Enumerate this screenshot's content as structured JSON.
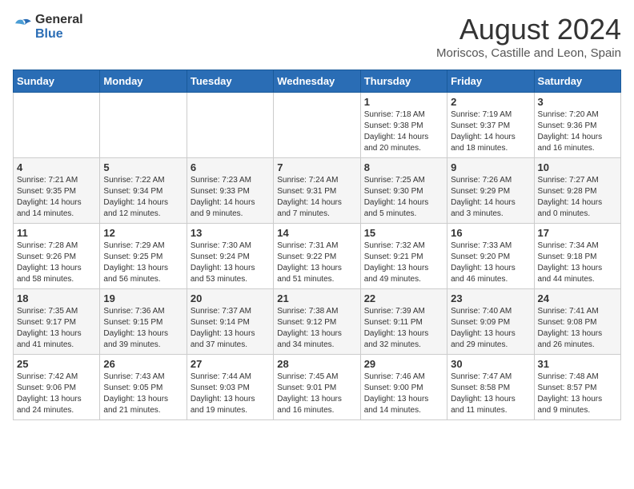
{
  "header": {
    "logo_general": "General",
    "logo_blue": "Blue",
    "month_year": "August 2024",
    "location": "Moriscos, Castille and Leon, Spain"
  },
  "weekdays": [
    "Sunday",
    "Monday",
    "Tuesday",
    "Wednesday",
    "Thursday",
    "Friday",
    "Saturday"
  ],
  "weeks": [
    [
      {
        "day": "",
        "info": ""
      },
      {
        "day": "",
        "info": ""
      },
      {
        "day": "",
        "info": ""
      },
      {
        "day": "",
        "info": ""
      },
      {
        "day": "1",
        "info": "Sunrise: 7:18 AM\nSunset: 9:38 PM\nDaylight: 14 hours and 20 minutes."
      },
      {
        "day": "2",
        "info": "Sunrise: 7:19 AM\nSunset: 9:37 PM\nDaylight: 14 hours and 18 minutes."
      },
      {
        "day": "3",
        "info": "Sunrise: 7:20 AM\nSunset: 9:36 PM\nDaylight: 14 hours and 16 minutes."
      }
    ],
    [
      {
        "day": "4",
        "info": "Sunrise: 7:21 AM\nSunset: 9:35 PM\nDaylight: 14 hours and 14 minutes."
      },
      {
        "day": "5",
        "info": "Sunrise: 7:22 AM\nSunset: 9:34 PM\nDaylight: 14 hours and 12 minutes."
      },
      {
        "day": "6",
        "info": "Sunrise: 7:23 AM\nSunset: 9:33 PM\nDaylight: 14 hours and 9 minutes."
      },
      {
        "day": "7",
        "info": "Sunrise: 7:24 AM\nSunset: 9:31 PM\nDaylight: 14 hours and 7 minutes."
      },
      {
        "day": "8",
        "info": "Sunrise: 7:25 AM\nSunset: 9:30 PM\nDaylight: 14 hours and 5 minutes."
      },
      {
        "day": "9",
        "info": "Sunrise: 7:26 AM\nSunset: 9:29 PM\nDaylight: 14 hours and 3 minutes."
      },
      {
        "day": "10",
        "info": "Sunrise: 7:27 AM\nSunset: 9:28 PM\nDaylight: 14 hours and 0 minutes."
      }
    ],
    [
      {
        "day": "11",
        "info": "Sunrise: 7:28 AM\nSunset: 9:26 PM\nDaylight: 13 hours and 58 minutes."
      },
      {
        "day": "12",
        "info": "Sunrise: 7:29 AM\nSunset: 9:25 PM\nDaylight: 13 hours and 56 minutes."
      },
      {
        "day": "13",
        "info": "Sunrise: 7:30 AM\nSunset: 9:24 PM\nDaylight: 13 hours and 53 minutes."
      },
      {
        "day": "14",
        "info": "Sunrise: 7:31 AM\nSunset: 9:22 PM\nDaylight: 13 hours and 51 minutes."
      },
      {
        "day": "15",
        "info": "Sunrise: 7:32 AM\nSunset: 9:21 PM\nDaylight: 13 hours and 49 minutes."
      },
      {
        "day": "16",
        "info": "Sunrise: 7:33 AM\nSunset: 9:20 PM\nDaylight: 13 hours and 46 minutes."
      },
      {
        "day": "17",
        "info": "Sunrise: 7:34 AM\nSunset: 9:18 PM\nDaylight: 13 hours and 44 minutes."
      }
    ],
    [
      {
        "day": "18",
        "info": "Sunrise: 7:35 AM\nSunset: 9:17 PM\nDaylight: 13 hours and 41 minutes."
      },
      {
        "day": "19",
        "info": "Sunrise: 7:36 AM\nSunset: 9:15 PM\nDaylight: 13 hours and 39 minutes."
      },
      {
        "day": "20",
        "info": "Sunrise: 7:37 AM\nSunset: 9:14 PM\nDaylight: 13 hours and 37 minutes."
      },
      {
        "day": "21",
        "info": "Sunrise: 7:38 AM\nSunset: 9:12 PM\nDaylight: 13 hours and 34 minutes."
      },
      {
        "day": "22",
        "info": "Sunrise: 7:39 AM\nSunset: 9:11 PM\nDaylight: 13 hours and 32 minutes."
      },
      {
        "day": "23",
        "info": "Sunrise: 7:40 AM\nSunset: 9:09 PM\nDaylight: 13 hours and 29 minutes."
      },
      {
        "day": "24",
        "info": "Sunrise: 7:41 AM\nSunset: 9:08 PM\nDaylight: 13 hours and 26 minutes."
      }
    ],
    [
      {
        "day": "25",
        "info": "Sunrise: 7:42 AM\nSunset: 9:06 PM\nDaylight: 13 hours and 24 minutes."
      },
      {
        "day": "26",
        "info": "Sunrise: 7:43 AM\nSunset: 9:05 PM\nDaylight: 13 hours and 21 minutes."
      },
      {
        "day": "27",
        "info": "Sunrise: 7:44 AM\nSunset: 9:03 PM\nDaylight: 13 hours and 19 minutes."
      },
      {
        "day": "28",
        "info": "Sunrise: 7:45 AM\nSunset: 9:01 PM\nDaylight: 13 hours and 16 minutes."
      },
      {
        "day": "29",
        "info": "Sunrise: 7:46 AM\nSunset: 9:00 PM\nDaylight: 13 hours and 14 minutes."
      },
      {
        "day": "30",
        "info": "Sunrise: 7:47 AM\nSunset: 8:58 PM\nDaylight: 13 hours and 11 minutes."
      },
      {
        "day": "31",
        "info": "Sunrise: 7:48 AM\nSunset: 8:57 PM\nDaylight: 13 hours and 9 minutes."
      }
    ]
  ]
}
